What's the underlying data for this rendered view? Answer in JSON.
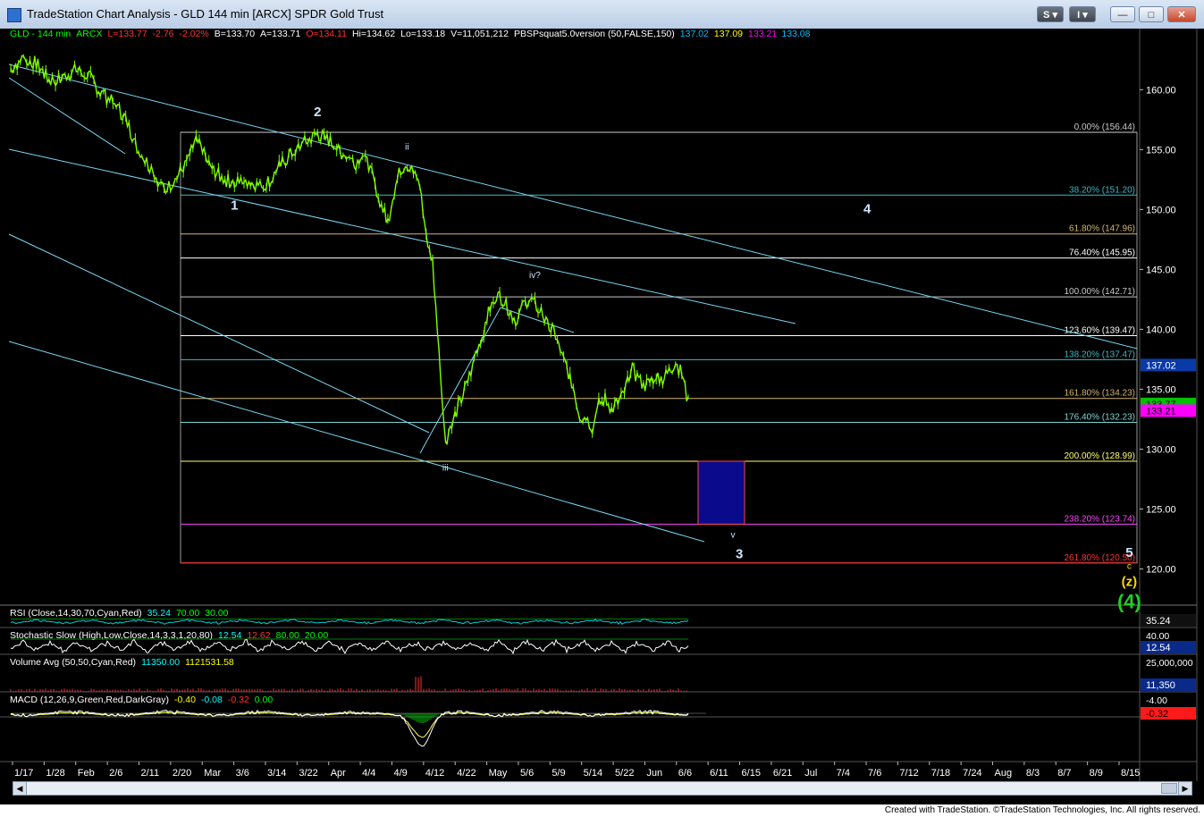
{
  "window": {
    "title": "TradeStation Chart Analysis - GLD 144 min [ARCX] SPDR Gold Trust",
    "buttons": {
      "s_label": "S",
      "i_label": "I",
      "minimize": "—",
      "maximize": "□",
      "close": "✕"
    }
  },
  "header": [
    {
      "text": "GLD - 144 min",
      "color": "#00ff00"
    },
    {
      "text": "ARCX",
      "color": "#00ff00"
    },
    {
      "text": "L=133.77",
      "color": "#ff3030"
    },
    {
      "text": "-2.76",
      "color": "#ff3030"
    },
    {
      "text": "-2.02%",
      "color": "#ff3030"
    },
    {
      "text": "B=133.70",
      "color": "#ffffff"
    },
    {
      "text": "A=133.71",
      "color": "#ffffff"
    },
    {
      "text": "O=134.11",
      "color": "#ff3030"
    },
    {
      "text": "Hi=134.62",
      "color": "#ffffff"
    },
    {
      "text": "Lo=133.18",
      "color": "#ffffff"
    },
    {
      "text": "V=11,051,212",
      "color": "#ffffff"
    },
    {
      "text": "PBSPsquat5.0version (50,FALSE,150)",
      "color": "#ffffff"
    },
    {
      "text": "137.02",
      "color": "#00bfff"
    },
    {
      "text": "137.09",
      "color": "#ffff00"
    },
    {
      "text": "133.21",
      "color": "#ff00ff"
    },
    {
      "text": "133.08",
      "color": "#00bfff"
    }
  ],
  "colors": {
    "background": "#000000",
    "price": "#7fff00",
    "channel": "#79d4f2",
    "fib_box": "#999999",
    "target_box": "#0a0a8c",
    "wave_white": "#cde6ff",
    "wave_yellow": "#ffd700",
    "wave_green": "#22cc22",
    "rsi": "#00d0d0",
    "macd": "#00ff66",
    "macd_signal": "#ffff55"
  },
  "chart_data": [
    {
      "type": "candlestick",
      "title": "GLD - 144 min",
      "x_ticks": [
        "1/17",
        "1/28",
        "Feb",
        "2/6",
        "2/11",
        "2/20",
        "Mar",
        "3/6",
        "3/14",
        "3/22",
        "Apr",
        "4/4",
        "4/9",
        "4/12",
        "4/22",
        "May",
        "5/6",
        "5/9",
        "5/14",
        "5/22",
        "Jun",
        "6/6",
        "6/11",
        "6/15",
        "6/21",
        "Jul",
        "7/4",
        "7/6",
        "7/12",
        "7/18",
        "7/24",
        "Aug",
        "8/3",
        "8/7",
        "8/9",
        "8/15"
      ],
      "ylim": [
        117.5,
        164.5
      ],
      "y_ticks": [
        160.0,
        155.0,
        150.0,
        145.0,
        140.0,
        135.0,
        130.0,
        125.0,
        120.0
      ],
      "price_path": [
        [
          0,
          161.8
        ],
        [
          2,
          162.6
        ],
        [
          4,
          162.2
        ],
        [
          6,
          160.8
        ],
        [
          8,
          160.9
        ],
        [
          10,
          161.6
        ],
        [
          12,
          161.3
        ],
        [
          14,
          159.8
        ],
        [
          16,
          158.9
        ],
        [
          18,
          157.6
        ],
        [
          20,
          154.8
        ],
        [
          22,
          153.5
        ],
        [
          24,
          151.5
        ],
        [
          26,
          152.6
        ],
        [
          28,
          154.6
        ],
        [
          29,
          155.8
        ],
        [
          31,
          153.8
        ],
        [
          33,
          152.6
        ],
        [
          35,
          152.2
        ],
        [
          37,
          152.4
        ],
        [
          39,
          151.9
        ],
        [
          41,
          152.6
        ],
        [
          42,
          153.6
        ],
        [
          44,
          154.7
        ],
        [
          46,
          155.6
        ],
        [
          48,
          156.3
        ],
        [
          50,
          155.7
        ],
        [
          52,
          154.6
        ],
        [
          54,
          153.9
        ],
        [
          55,
          154.9
        ],
        [
          56,
          153.6
        ],
        [
          57,
          152.1
        ],
        [
          58,
          150.3
        ],
        [
          59,
          149.0
        ],
        [
          60,
          151.6
        ],
        [
          61,
          153.4
        ],
        [
          62,
          153.9
        ],
        [
          63,
          153.0
        ],
        [
          64,
          151.9
        ],
        [
          65,
          148.0
        ],
        [
          66,
          145.5
        ],
        [
          67,
          138.0
        ],
        [
          68,
          130.5
        ],
        [
          69,
          132.3
        ],
        [
          70,
          133.5
        ],
        [
          71,
          134.8
        ],
        [
          72,
          136.5
        ],
        [
          73,
          138.5
        ],
        [
          74,
          140.0
        ],
        [
          75,
          141.8
        ],
        [
          76,
          142.9
        ],
        [
          77,
          142.5
        ],
        [
          78,
          141.5
        ],
        [
          79,
          140.8
        ],
        [
          81,
          142.6
        ],
        [
          83,
          141.5
        ],
        [
          84,
          140.2
        ],
        [
          85,
          139.8
        ],
        [
          86,
          138.0
        ],
        [
          87,
          136.8
        ],
        [
          88,
          135.2
        ],
        [
          89,
          132.8
        ],
        [
          90,
          132.6
        ],
        [
          91,
          131.8
        ],
        [
          92,
          133.8
        ],
        [
          93,
          134.2
        ],
        [
          94,
          133.3
        ],
        [
          95,
          133.9
        ],
        [
          96,
          134.8
        ],
        [
          97,
          136.8
        ],
        [
          98,
          136.0
        ],
        [
          99,
          135.2
        ],
        [
          100,
          135.6
        ],
        [
          101,
          136.3
        ],
        [
          102,
          135.8
        ],
        [
          103,
          136.5
        ],
        [
          104,
          137.2
        ],
        [
          105,
          136.3
        ],
        [
          106,
          133.8
        ]
      ],
      "bars_total": 106,
      "fib_levels": [
        {
          "label": "0.00% (156.44)",
          "price": 156.44,
          "color": "#c8c8c8"
        },
        {
          "label": "38.20% (151.20)",
          "price": 151.2,
          "color": "#3fb8c0"
        },
        {
          "label": "61.80% (147.96)",
          "price": 147.96,
          "color": "#d4b56a"
        },
        {
          "label": "76.40% (145.95)",
          "price": 145.95,
          "color": "#ffffff"
        },
        {
          "label": "100.00% (142.71)",
          "price": 142.71,
          "color": "#c8c8c8"
        },
        {
          "label": "123.60% (139.47)",
          "price": 139.47,
          "color": "#ffffff"
        },
        {
          "label": "138.20% (137.47)",
          "price": 137.47,
          "color": "#3fb8c0"
        },
        {
          "label": "161.80% (134.23)",
          "price": 134.23,
          "color": "#d4b56a"
        },
        {
          "label": "176.40% (132.23)",
          "price": 132.23,
          "color": "#7fd4d4"
        },
        {
          "label": "200.00% (128.99)",
          "price": 128.99,
          "color": "#ffff66"
        },
        {
          "label": "238.20% (123.74)",
          "price": 123.74,
          "color": "#ff44ff"
        },
        {
          "label": "261.80% (120.50)",
          "price": 120.5,
          "color": "#ff3030"
        }
      ],
      "wave_labels": [
        {
          "text": "1",
          "bar": 35,
          "price": 150.0,
          "color": "#cde6ff",
          "size": "medium"
        },
        {
          "text": "2",
          "bar": 48,
          "price": 157.8,
          "color": "#cde6ff",
          "size": "medium"
        },
        {
          "text": "ii",
          "bar": 62,
          "price": 155.0,
          "color": "#cde6ff",
          "size": "small"
        },
        {
          "text": "iii",
          "bar": 68,
          "price": 128.2,
          "color": "#cde6ff",
          "size": "small"
        },
        {
          "text": "iv?",
          "bar": 82,
          "price": 144.3,
          "color": "#cde6ff",
          "size": "small"
        },
        {
          "text": "v",
          "bar": 113,
          "price": 122.6,
          "color": "#cde6ff",
          "size": "small"
        },
        {
          "text": "3",
          "bar": 114,
          "price": 120.9,
          "color": "#cde6ff",
          "size": "medium"
        },
        {
          "text": "4",
          "bar": 134,
          "price": 149.7,
          "color": "#cde6ff",
          "size": "medium"
        },
        {
          "text": "5",
          "bar": 175,
          "price": 121.0,
          "color": "#cde6ff",
          "size": "medium"
        },
        {
          "text": "c",
          "bar": 175,
          "price": 120.0,
          "color": "#ffd700",
          "size": "small"
        },
        {
          "text": "(z)",
          "bar": 175,
          "price": 118.6,
          "color": "#ffd700",
          "size": "medium"
        },
        {
          "text": "(4)",
          "bar": 175,
          "price": 116.7,
          "color": "#22cc22",
          "size": "large"
        }
      ],
      "price_tags": [
        {
          "text": "137.02",
          "price": 137.02,
          "bg": "#0a3aa8",
          "fg": "#ffffff"
        },
        {
          "text": "133.77",
          "price": 133.77,
          "bg": "#00c000",
          "fg": "#000000"
        },
        {
          "text": "133.21",
          "price": 133.21,
          "bg": "#ff00ff",
          "fg": "#000000"
        }
      ],
      "target_zone": {
        "price_top": 128.99,
        "price_bottom": 123.74
      }
    },
    {
      "type": "line",
      "title": "RSI (Close,14,30,70,Cyan,Red)",
      "values_shown": [
        {
          "text": "35.24",
          "color": "#00ffff"
        },
        {
          "text": "70.00",
          "color": "#00ff00"
        },
        {
          "text": "30.00",
          "color": "#00ff00"
        }
      ],
      "last": "35.24"
    },
    {
      "type": "line",
      "title": "Stochastic Slow (High,Low,Close,14,3,3,1,20,80)",
      "values_shown": [
        {
          "text": "12.54",
          "color": "#00ffff"
        },
        {
          "text": "12.62",
          "color": "#ff3030"
        },
        {
          "text": "80.00",
          "color": "#00ff00"
        },
        {
          "text": "20.00",
          "color": "#00ff00"
        }
      ],
      "axis_tick": "40.00",
      "last": "12.54"
    },
    {
      "type": "bar",
      "title": "Volume Avg (50,50,Cyan,Red)",
      "values_shown": [
        {
          "text": "11350.00",
          "color": "#00ffff"
        },
        {
          "text": "1121531.58",
          "color": "#ffff00"
        }
      ],
      "axis_tick": "25,000,000",
      "last": "11,350"
    },
    {
      "type": "line",
      "title": "MACD (12,26,9,Green,Red,DarkGray)",
      "values_shown": [
        {
          "text": "-0.40",
          "color": "#ffff00"
        },
        {
          "text": "-0.08",
          "color": "#00ffff"
        },
        {
          "text": "-0.32",
          "color": "#ff3030"
        },
        {
          "text": "0.00",
          "color": "#00ff00"
        }
      ],
      "axis_tick": "-4.00",
      "last": "-0.32"
    }
  ],
  "footer": {
    "credit": "Created with TradeStation. ©TradeStation Technologies, Inc. All rights reserved."
  }
}
